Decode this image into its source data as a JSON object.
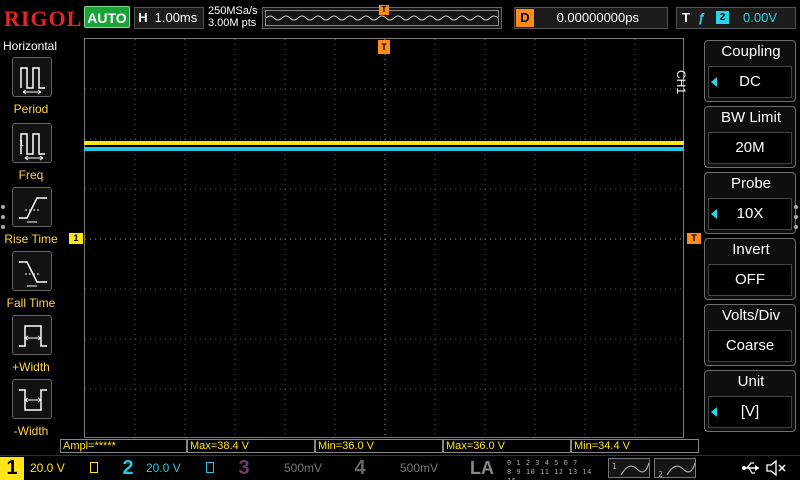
{
  "brand": "RIGOL",
  "run_state": "AUTO",
  "horizontal": {
    "letter": "H",
    "timebase": "1.00ms"
  },
  "acquisition": {
    "sample_rate": "250MSa/s",
    "memory_depth": "3.00M pts"
  },
  "memory_bar": {
    "trigger_marker": "T"
  },
  "delay": {
    "letter": "D",
    "value": "0.00000000ps"
  },
  "trigger": {
    "letter": "T",
    "edge": "ƒ",
    "source": "2",
    "level": "0.00V"
  },
  "left_menu": {
    "title": "Horizontal",
    "items": [
      {
        "label": "Period",
        "icon": "period-icon"
      },
      {
        "label": "Freq",
        "icon": "freq-icon"
      },
      {
        "label": "Rise Time",
        "icon": "rise-time-icon"
      },
      {
        "label": "Fall Time",
        "icon": "fall-time-icon"
      },
      {
        "label": "+Width",
        "icon": "positive-width-icon"
      },
      {
        "label": "-Width",
        "icon": "negative-width-icon"
      }
    ]
  },
  "right_menu": {
    "channel": "CH1",
    "items": [
      {
        "title": "Coupling",
        "value": "DC"
      },
      {
        "title": "BW Limit",
        "value": "20M"
      },
      {
        "title": "Probe",
        "value": "10X"
      },
      {
        "title": "Invert",
        "value": "OFF"
      },
      {
        "title": "Volts/Div",
        "value": "Coarse"
      },
      {
        "title": "Unit",
        "value": "[V]"
      }
    ]
  },
  "markers": {
    "channel1": "1",
    "trigger_level": "T",
    "trigger_position": "T"
  },
  "measurements": [
    {
      "text": "Ampl=*****"
    },
    {
      "text": "Max=38.4 V"
    },
    {
      "text": "Min=36.0 V"
    },
    {
      "text": "Max=36.0 V"
    },
    {
      "text": "Min=34.4 V"
    }
  ],
  "channels": [
    {
      "num": "1",
      "scale": "20.0 V",
      "color": "#ffe41a",
      "active": true
    },
    {
      "num": "2",
      "scale": "20.0 V",
      "color": "#26c8e0",
      "active": true
    },
    {
      "num": "3",
      "scale": "500mV",
      "color": "#6b3a6b",
      "active": false
    },
    {
      "num": "4",
      "scale": "500mV",
      "color": "#666666",
      "active": false
    }
  ],
  "la": {
    "label": "LA",
    "rows": [
      "0 1 2 3  4 5 6 7",
      "8 9 10 11 12 13 14 15"
    ]
  },
  "decoders": [
    {
      "id": "1"
    },
    {
      "id": "2"
    }
  ],
  "colors": {
    "ch1": "#ffe41a",
    "ch2": "#26c8e0",
    "trigger": "#ff8c1a",
    "accent": "#2ad4e8",
    "brand": "#e8251f"
  }
}
